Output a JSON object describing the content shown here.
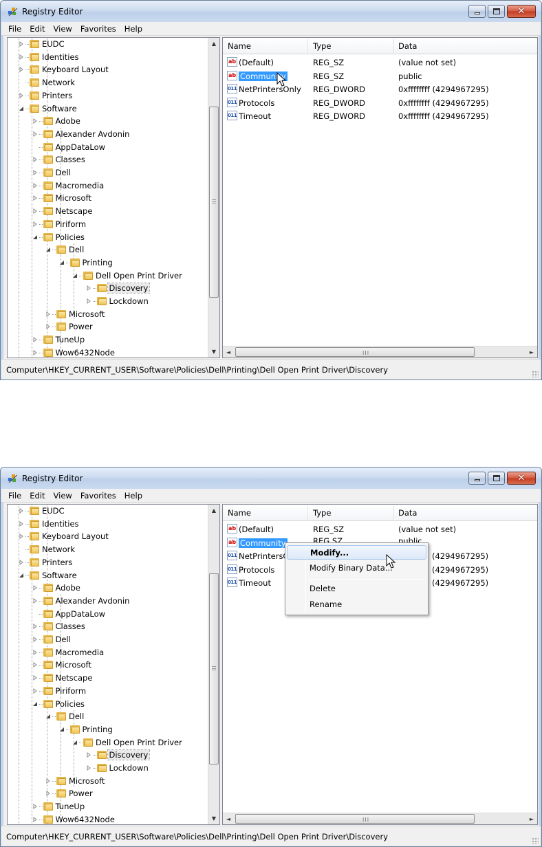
{
  "window": {
    "title": "Registry Editor",
    "menu": [
      "File",
      "Edit",
      "View",
      "Favorites",
      "Help"
    ],
    "close_glyph": "✕"
  },
  "tree": {
    "items": [
      {
        "label": "EUDC",
        "expander": "closed"
      },
      {
        "label": "Identities",
        "expander": "closed"
      },
      {
        "label": "Keyboard Layout",
        "expander": "closed"
      },
      {
        "label": "Network",
        "expander": "none"
      },
      {
        "label": "Printers",
        "expander": "closed"
      },
      {
        "label": "Software",
        "expander": "open"
      },
      {
        "label": "Adobe",
        "expander": "closed"
      },
      {
        "label": "Alexander Avdonin",
        "expander": "closed"
      },
      {
        "label": "AppDataLow",
        "expander": "none"
      },
      {
        "label": "Classes",
        "expander": "closed"
      },
      {
        "label": "Dell",
        "expander": "closed"
      },
      {
        "label": "Macromedia",
        "expander": "closed"
      },
      {
        "label": "Microsoft",
        "expander": "closed"
      },
      {
        "label": "Netscape",
        "expander": "closed"
      },
      {
        "label": "Piriform",
        "expander": "closed"
      },
      {
        "label": "Policies",
        "expander": "open"
      },
      {
        "label": "Dell",
        "expander": "open"
      },
      {
        "label": "Printing",
        "expander": "open"
      },
      {
        "label": "Dell Open Print Driver",
        "expander": "open"
      },
      {
        "label": "Discovery",
        "expander": "closed",
        "selected": true
      },
      {
        "label": "Lockdown",
        "expander": "closed"
      },
      {
        "label": "Microsoft",
        "expander": "closed"
      },
      {
        "label": "Power",
        "expander": "closed"
      },
      {
        "label": "TuneUp",
        "expander": "closed"
      },
      {
        "label": "Wow6432Node",
        "expander": "closed"
      }
    ]
  },
  "list": {
    "columns": {
      "name": "Name",
      "type": "Type",
      "data": "Data"
    },
    "rows": [
      {
        "icon": "ab",
        "name": "(Default)",
        "type": "REG_SZ",
        "data": "(value not set)"
      },
      {
        "icon": "ab",
        "name": "Community",
        "type": "REG_SZ",
        "data": "public",
        "selected": true
      },
      {
        "icon": "011",
        "name": "NetPrintersOnly",
        "type": "REG_DWORD",
        "data": "0xffffffff (4294967295)"
      },
      {
        "icon": "011",
        "name": "Protocols",
        "type": "REG_DWORD",
        "data": "0xffffffff (4294967295)"
      },
      {
        "icon": "011",
        "name": "Timeout",
        "type": "REG_DWORD",
        "data": "0xffffffff (4294967295)"
      }
    ],
    "second_screen": {
      "community_type": "REG SZ",
      "community_data": "public",
      "netprinters_name": "NetPrintersC",
      "dword_data": "(4294967295)"
    }
  },
  "status": {
    "path": "Computer\\HKEY_CURRENT_USER\\Software\\Policies\\Dell\\Printing\\Dell Open Print Driver\\Discovery"
  },
  "context_menu": {
    "items": [
      "Modify...",
      "Modify Binary Data...",
      "Delete",
      "Rename"
    ]
  },
  "scroll": {
    "grip": "III",
    "up": "▲",
    "down": "▼",
    "left": "◄",
    "right": "►"
  },
  "colors": {
    "selection": "#3399ff",
    "title_bar": "#c4d6ec",
    "close_button": "#c23c22"
  }
}
